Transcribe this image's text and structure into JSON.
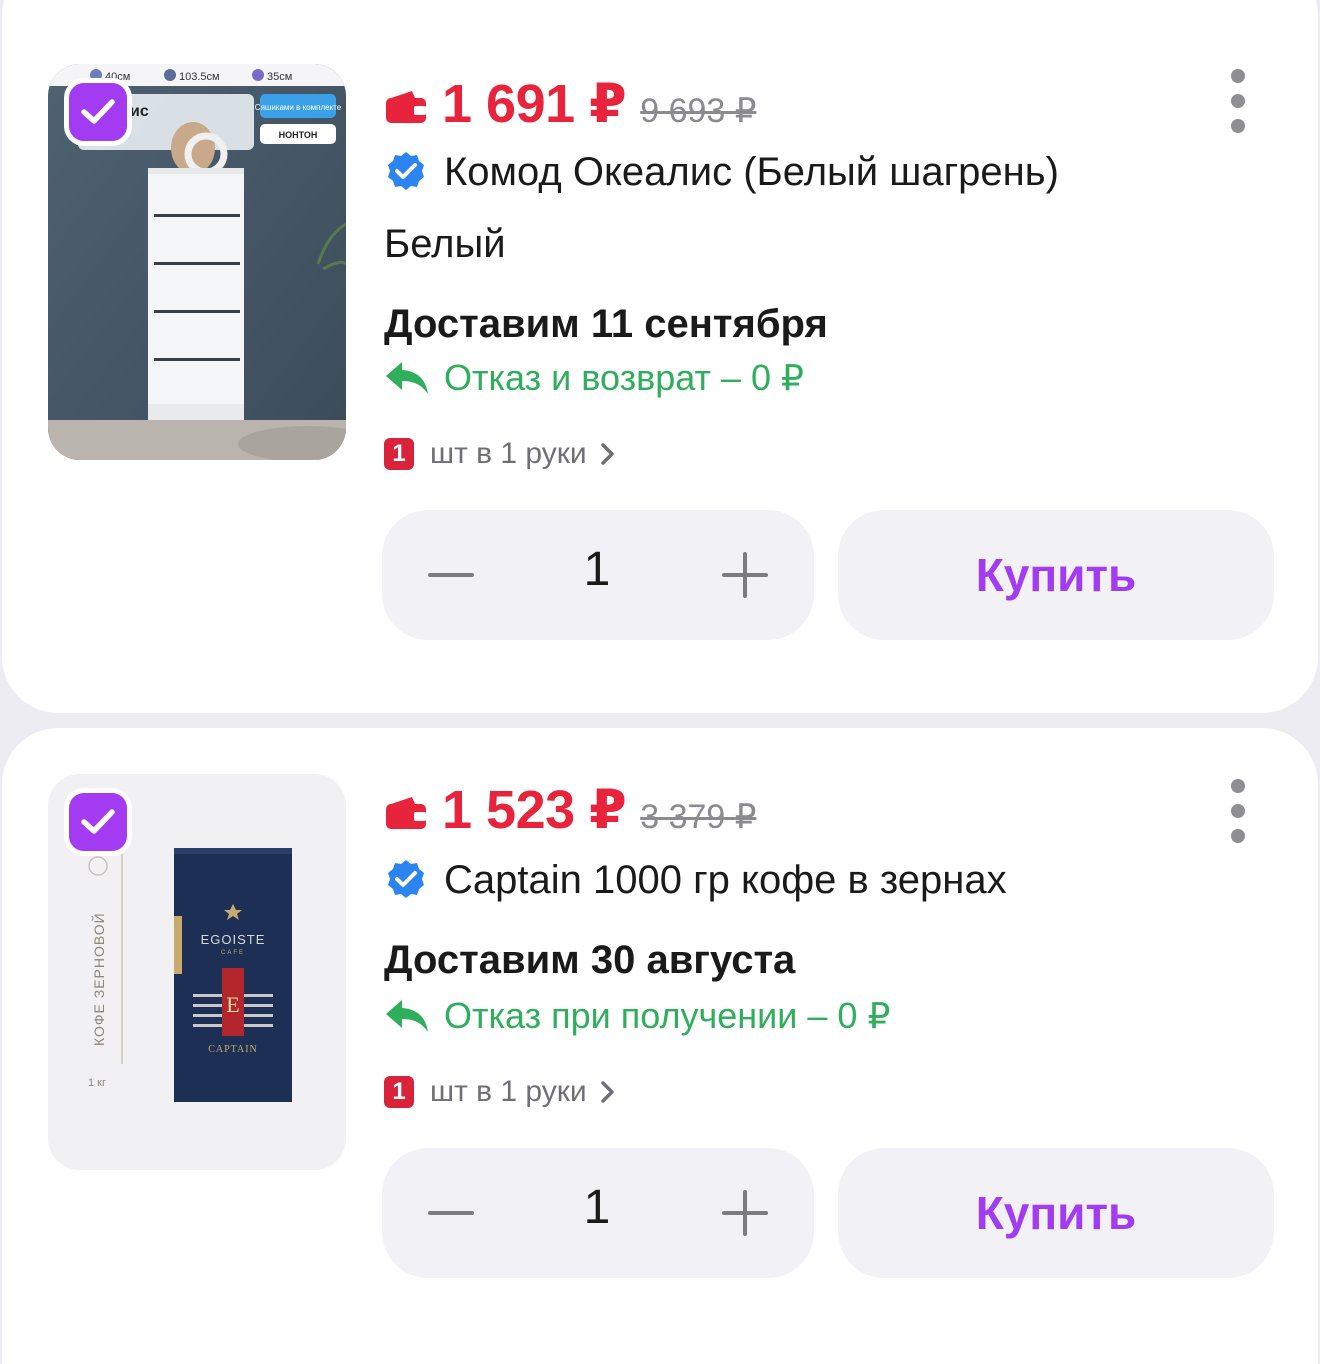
{
  "colors": {
    "accent": "#a23bf2",
    "price_red": "#e8243c",
    "return_green": "#2fae5c",
    "verified_blue": "#2b84f0",
    "card_bg": "#ffffff",
    "page_bg": "#ececf2"
  },
  "items": [
    {
      "checked": true,
      "image": {
        "kind": "product-photo-dresser",
        "overlay_labels": [
          "40см",
          "103.5см",
          "35см",
          "ис",
          "Сяшиками в комплекте",
          "HOHTOH"
        ]
      },
      "price": "1 691 ₽",
      "old_price": "9 693 ₽",
      "title": "Комод Океалис (Белый шагрень)",
      "variant": "Белый",
      "delivery": "Доставим 11 сентября",
      "return_text": "Отказ и возврат – 0 ₽",
      "limit_badge": "1",
      "limit_text": "шт в 1 руки",
      "quantity": "1",
      "buy_label": "Купить",
      "icons": {
        "wallet": "wallet-icon",
        "verified": "verified-check-icon",
        "return": "return-arrow-icon",
        "more": "more-vertical-icon",
        "minus": "minus-icon",
        "plus": "plus-icon",
        "chevron": "chevron-right-icon"
      }
    },
    {
      "checked": true,
      "image": {
        "kind": "product-photo-coffee-bag",
        "overlay_labels": [
          "КОФЕ ЗЕРНОВОЙ",
          "1 кг",
          "EGOISTE",
          "CAFE",
          "E",
          "CAPTAIN"
        ]
      },
      "price": "1 523 ₽",
      "old_price": "3 379 ₽",
      "title": "Captain 1000 гр кофе в зернах",
      "delivery": "Доставим 30 августа",
      "return_text": "Отказ при получении – 0 ₽",
      "limit_badge": "1",
      "limit_text": "шт в 1 руки",
      "quantity": "1",
      "buy_label": "Купить",
      "icons": {
        "wallet": "wallet-icon",
        "verified": "verified-check-icon",
        "return": "return-arrow-icon",
        "more": "more-vertical-icon",
        "minus": "minus-icon",
        "plus": "plus-icon",
        "chevron": "chevron-right-icon"
      }
    }
  ]
}
